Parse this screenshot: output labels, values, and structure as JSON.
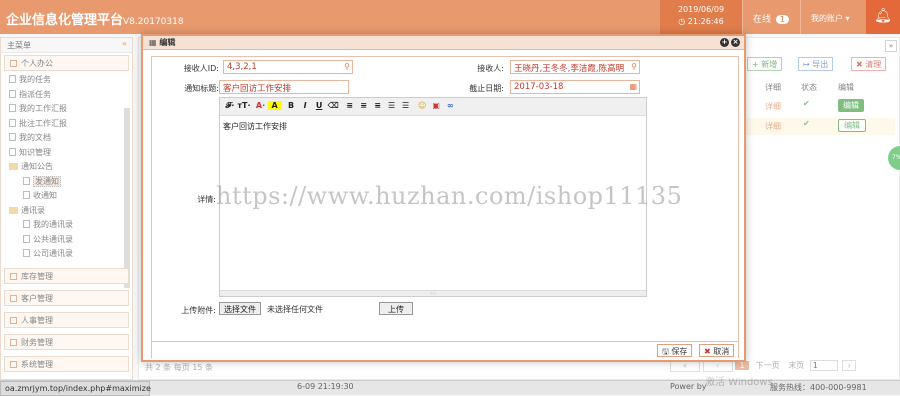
{
  "header": {
    "brand": "企业信息化管理平台",
    "version": "V8.20170318",
    "date": "2019/06/09",
    "time": "21:26:46",
    "online_label": "在线",
    "online_count": "1",
    "account_label": "我的账户"
  },
  "sidebar": {
    "title": "主菜单",
    "section_office": "个人办公",
    "items": [
      "我的任务",
      "指派任务",
      "我的工作汇报",
      "批注工作汇报",
      "我的文档",
      "知识管理"
    ],
    "notice_folder": "通知公告",
    "notice_items": [
      "发通知",
      "收通知"
    ],
    "contacts_folder": "通讯录",
    "contacts_items": [
      "我的通讯录",
      "公共通讯录",
      "公司通讯录"
    ],
    "sections": [
      "库存管理",
      "客户管理",
      "人事管理",
      "财务管理",
      "系统管理"
    ]
  },
  "background": {
    "add_label": "新增",
    "export_label": "导出",
    "clear_label": "清理",
    "col_detail": "详细",
    "col_status": "状态",
    "col_edit": "编辑",
    "row_detail": "详细",
    "row_edit": "编辑",
    "footer_total": "共 2 条 每页 15 条",
    "next_page": "下一页",
    "last_page": "末页",
    "page_num": "1",
    "datetime_partial": "6-09 21:19:30",
    "powered": "Power by",
    "hotline": "服务热线：400-000-9981",
    "activate": "激活 Windows"
  },
  "modal": {
    "title": "编辑",
    "recv_id_label": "接收人ID:",
    "recv_id_value": "4,3,2,1",
    "recv_label": "接收人:",
    "recv_value": "王晓丹,王冬冬,李洁霞,陈高明",
    "subject_label": "通知标题:",
    "subject_value": "客户回访工作安排",
    "deadline_label": "截止日期:",
    "deadline_value": "2017-03-18",
    "detail_label": "详情:",
    "editor_text": "客户回访工作安排",
    "attach_label": "上传附件:",
    "choose_file": "选择文件",
    "no_file": "未选择任何文件",
    "upload": "上传",
    "save": "保存",
    "cancel": "取消"
  },
  "statusbar": {
    "url": "oa.zmrjym.top/index.php#maximize"
  },
  "watermark": "https://www.huzhan.com/ishop11135"
}
